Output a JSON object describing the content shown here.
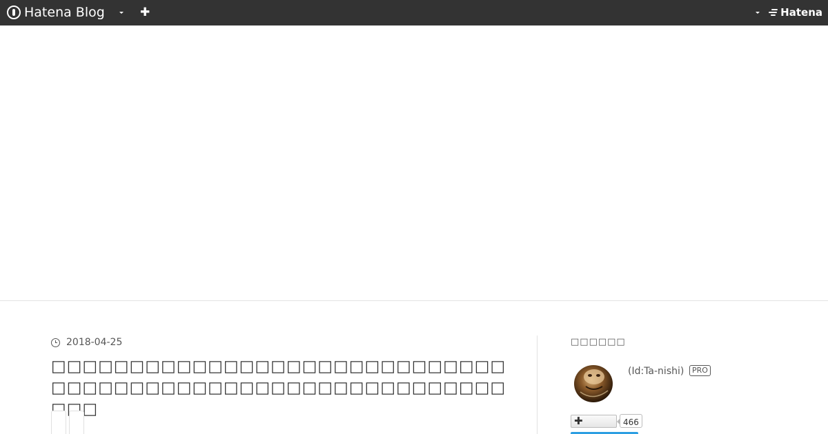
{
  "header": {
    "brand": "Hatena Blog",
    "hatena_label": "Hatena"
  },
  "entry": {
    "date": "2018-04-25",
    "title": "□□□□□□□□□□□□□□□□□□□□□□□□□□□□□□□□□□□□□□□□□□□□□□□□□□□□□□□□□□□□□"
  },
  "sidebar": {
    "heading": "□□□□□□",
    "user_id": "(Id:Ta-nishi)",
    "pro_badge": "PRO",
    "follower_count": "466"
  },
  "icons": {
    "brand": "hatena-blog-logo-icon",
    "menu": "chevron-down-icon",
    "add": "plus-icon",
    "clock": "clock-icon"
  }
}
